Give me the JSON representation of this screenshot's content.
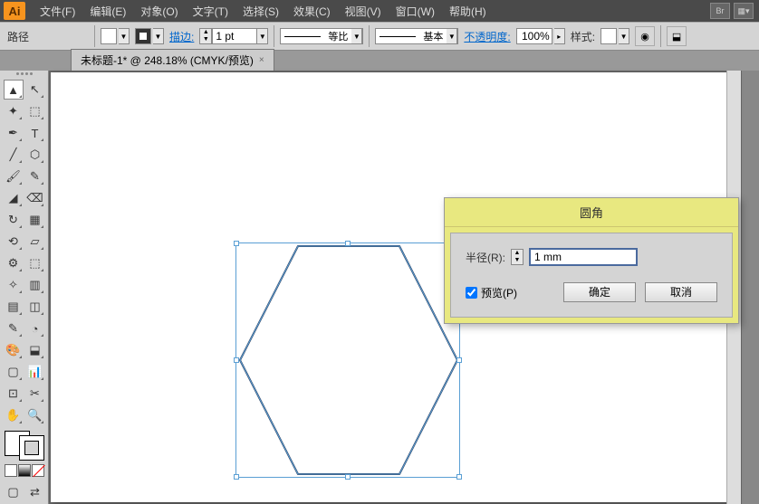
{
  "app": {
    "logo": "Ai"
  },
  "menu": {
    "items": [
      "文件(F)",
      "编辑(E)",
      "对象(O)",
      "文字(T)",
      "选择(S)",
      "效果(C)",
      "视图(V)",
      "窗口(W)",
      "帮助(H)"
    ],
    "br": "Br"
  },
  "ctrl": {
    "path_label": "路径",
    "stroke_label": "描边:",
    "stroke_val": "1 pt",
    "variable_width": "等比",
    "brush": "基本",
    "opacity_label": "不透明度:",
    "opacity_val": "100%",
    "style_label": "样式:"
  },
  "tab": {
    "title": "未标题-1* @ 248.18% (CMYK/预览)",
    "close": "×"
  },
  "dialog": {
    "title": "圆角",
    "radius_label": "半径(R):",
    "radius_val": "1 mm",
    "preview_label": "预览(P)",
    "ok": "确定",
    "cancel": "取消"
  },
  "tools": {
    "rows": [
      [
        "▲",
        "↖"
      ],
      [
        "✦",
        "⬚"
      ],
      [
        "✒",
        "T"
      ],
      [
        "╱",
        "⬡"
      ],
      [
        "🖌",
        "✎"
      ],
      [
        "◢",
        "⌫"
      ],
      [
        "↻",
        "▦"
      ],
      [
        "⟲",
        "▱"
      ],
      [
        "⚙",
        "⬚"
      ],
      [
        "✧",
        "▥"
      ],
      [
        "▤",
        "◫"
      ],
      [
        "✎",
        "◔"
      ],
      [
        "🎨",
        "⬓"
      ],
      [
        "▢",
        "📊"
      ],
      [
        "⊡",
        "✂"
      ],
      [
        "✋",
        "🔍"
      ]
    ]
  },
  "colors": [
    "#ffffff",
    "#000000",
    "#ff0000"
  ]
}
